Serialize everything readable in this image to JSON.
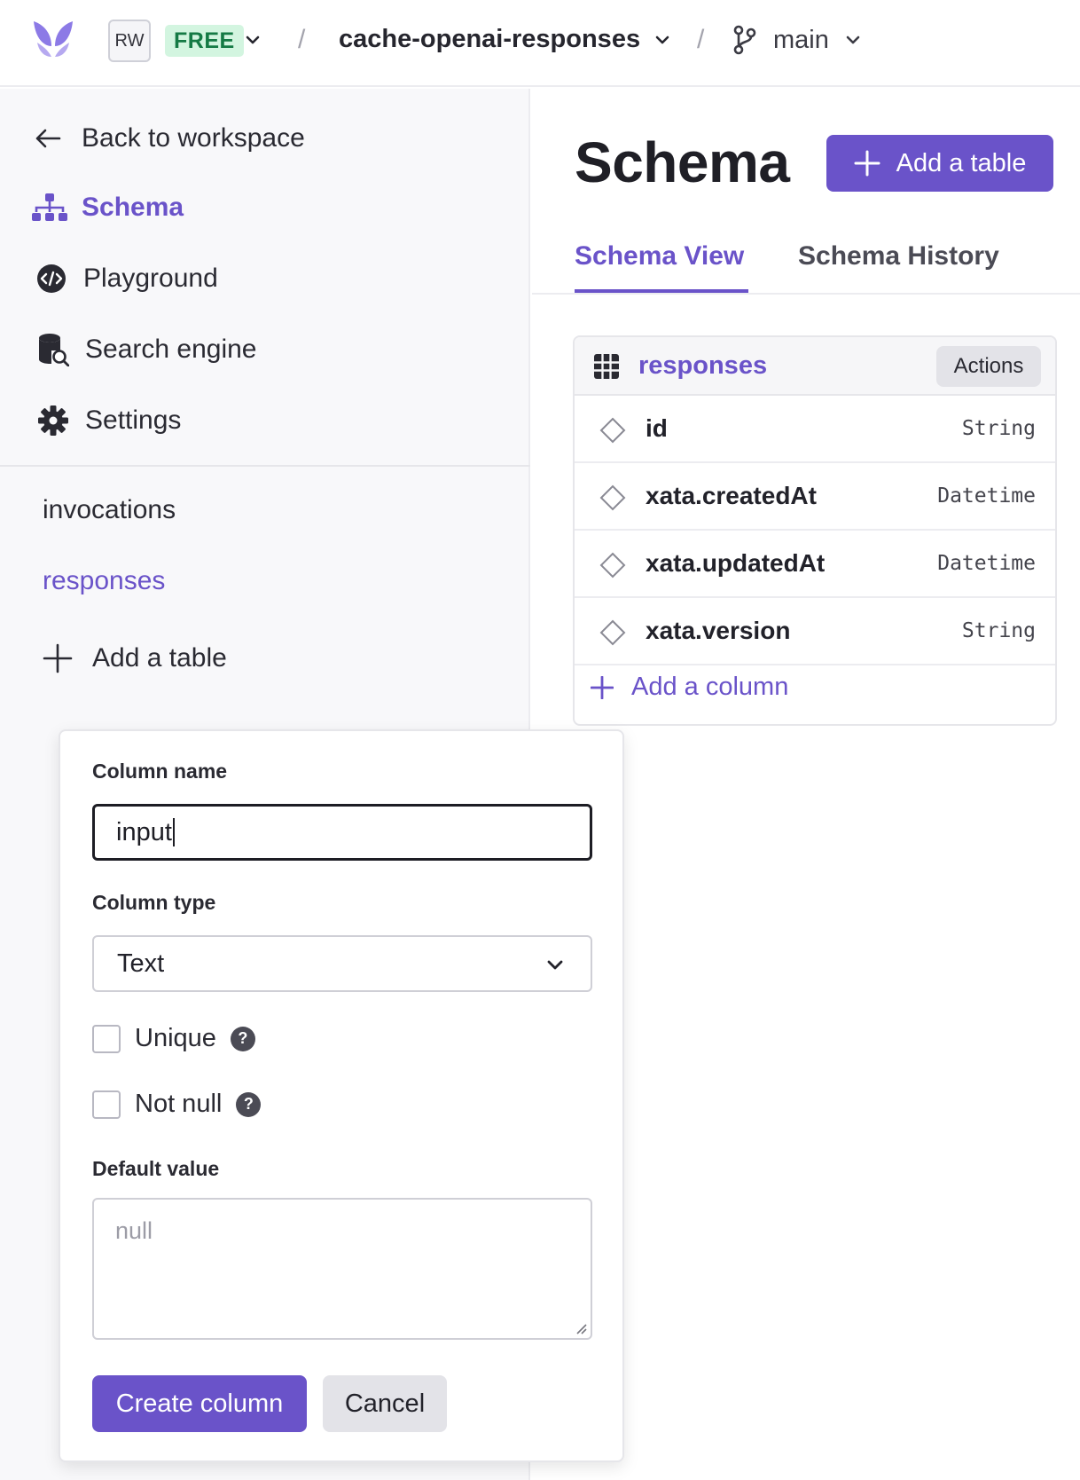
{
  "topbar": {
    "workspace_badge": "RW",
    "plan_badge": "FREE",
    "database_name": "cache-openai-responses",
    "branch_name": "main",
    "separator": "/"
  },
  "sidebar": {
    "back_label": "Back to workspace",
    "nav": [
      {
        "label": "Schema",
        "icon": "sitemap-icon",
        "active": true
      },
      {
        "label": "Playground",
        "icon": "code-icon",
        "active": false
      },
      {
        "label": "Search engine",
        "icon": "database-search-icon",
        "active": false
      },
      {
        "label": "Settings",
        "icon": "gear-icon",
        "active": false
      }
    ],
    "tables": [
      {
        "label": "invocations",
        "active": false
      },
      {
        "label": "responses",
        "active": true
      }
    ],
    "add_table_label": "Add a table"
  },
  "main": {
    "title": "Schema",
    "add_table_button": "Add a table",
    "tabs": [
      {
        "label": "Schema View",
        "active": true
      },
      {
        "label": "Schema History",
        "active": false
      }
    ],
    "table_card": {
      "name": "responses",
      "actions_label": "Actions",
      "columns": [
        {
          "name": "id",
          "type": "String"
        },
        {
          "name": "xata.createdAt",
          "type": "Datetime"
        },
        {
          "name": "xata.updatedAt",
          "type": "Datetime"
        },
        {
          "name": "xata.version",
          "type": "String"
        }
      ],
      "add_column_label": "Add a column"
    }
  },
  "popover": {
    "column_name_label": "Column name",
    "column_name_value": "input",
    "column_type_label": "Column type",
    "column_type_value": "Text",
    "unique_label": "Unique",
    "unique_checked": false,
    "not_null_label": "Not null",
    "not_null_checked": false,
    "help_glyph": "?",
    "default_value_label": "Default value",
    "default_value_placeholder": "null",
    "create_button": "Create column",
    "cancel_button": "Cancel"
  },
  "colors": {
    "accent": "#6a53c9",
    "plan_badge_bg": "#d3f5e0",
    "plan_badge_text": "#157a45"
  }
}
